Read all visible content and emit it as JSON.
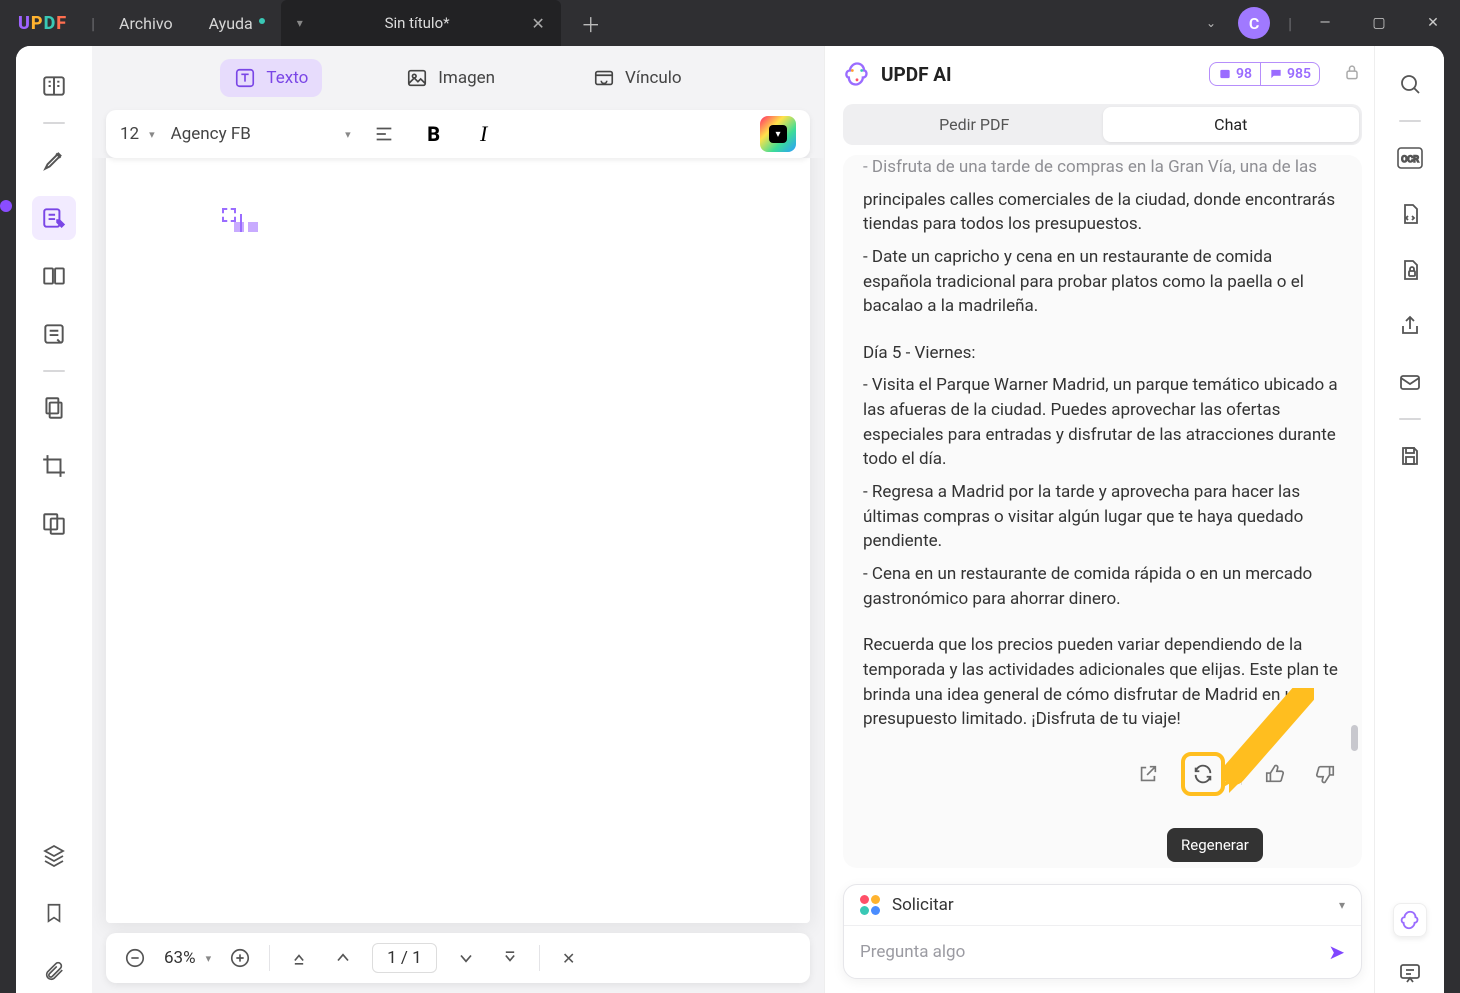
{
  "app": {
    "menu_file": "Archivo",
    "menu_help": "Ayuda",
    "tab_title": "Sin título*",
    "avatar": "C"
  },
  "edit_tabs": {
    "text": "Texto",
    "image": "Imagen",
    "link": "Vínculo"
  },
  "format": {
    "size": "12",
    "font": "Agency FB"
  },
  "zoom": {
    "value": "63%",
    "page": "1  /  1"
  },
  "ai": {
    "title": "UPDF AI",
    "badge1": "98",
    "badge2": "985",
    "tab_pdf": "Pedir PDF",
    "tab_chat": "Chat",
    "cut_line": "- Disfruta de una tarde de compras en la Gran Vía, una de las",
    "p1": "principales calles comerciales de la ciudad, donde encontrarás tiendas para todos los presupuestos.",
    "p2": "- Date un capricho y cena en un restaurante de comida española tradicional para probar platos como la paella o el bacalao a la madrileña.",
    "h5": "Día 5 - Viernes:",
    "p3": "- Visita el Parque Warner Madrid, un parque temático ubicado a las afueras de la ciudad. Puedes aprovechar las ofertas especiales para entradas y disfrutar de las atracciones durante todo el día.",
    "p4": "- Regresa a Madrid por la tarde y aprovecha para hacer las últimas compras o visitar algún lugar que te haya quedado pendiente.",
    "p5": "- Cena en un restaurante de comida rápida o en un mercado gastronómico para ahorrar dinero.",
    "p6": "Recuerda que los precios pueden variar dependiendo de la temporada y las actividades adicionales que elijas. Este plan te brinda una idea general de cómo disfrutar de Madrid en un presupuesto limitado. ¡Disfruta de tu viaje!",
    "tooltip": "Regenerar",
    "solicit": "Solicitar",
    "placeholder": "Pregunta algo"
  }
}
